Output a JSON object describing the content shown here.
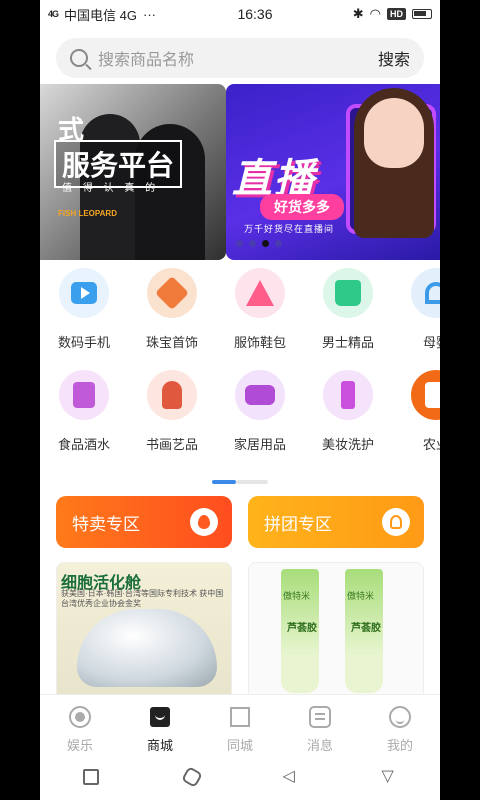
{
  "status": {
    "signal": "4G",
    "carrier": "中国电信 4G",
    "more": "···",
    "time": "16:36",
    "hd": "HD"
  },
  "search": {
    "placeholder": "搜索商品名称",
    "button": "搜索"
  },
  "banner": {
    "slide1": {
      "line1": "式",
      "line2": "服务平台",
      "line3": "值 得 认 真 的",
      "logo": "FISH LEOPARD"
    },
    "slide2": {
      "title": "直播",
      "pill": "好货多多",
      "sub": "万千好货尽在直播间"
    }
  },
  "categories": {
    "row1": [
      "数码手机",
      "珠宝首饰",
      "服饰鞋包",
      "男士精品",
      "母婴"
    ],
    "row2": [
      "食品酒水",
      "书画艺品",
      "家居用品",
      "美妆洗护",
      "农业"
    ]
  },
  "promos": {
    "special": "特卖专区",
    "group": "拼团专区"
  },
  "products": {
    "p1": {
      "title": "细胞活化舱",
      "sub": "获美国·日本·韩国·台湾等国际专利技术 获中国台湾优秀企业协会金奖"
    },
    "p2": {
      "brand": "傲特米",
      "name": "芦荟胶"
    }
  },
  "tabs": [
    "娱乐",
    "商城",
    "同城",
    "消息",
    "我的"
  ],
  "active_tab": "商城",
  "colors": {
    "promo_special": "#ff5a1f",
    "promo_group": "#ffa31a",
    "indicator": "#3a8be8"
  }
}
